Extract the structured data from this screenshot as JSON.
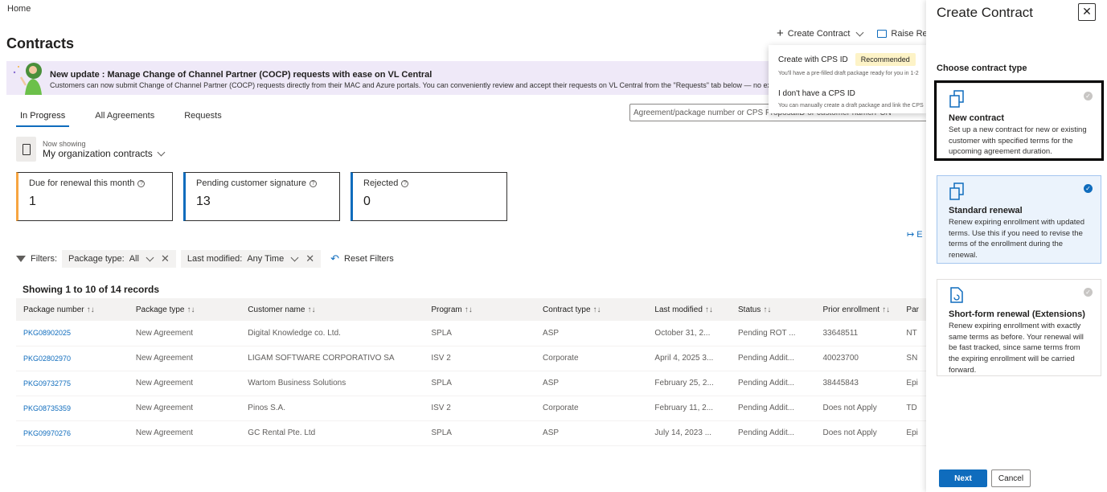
{
  "breadcrumb": "Home",
  "page_title": "Contracts",
  "top_actions": {
    "create_label": "Create Contract",
    "raise_label": "Raise Requ"
  },
  "banner": {
    "title": "New update : Manage Change of Channel Partner (COCP) requests with ease on VL Central",
    "text": "Customers can now submit Change of Channel Partner (COCP) requests directly from their MAC and Azure portals. You can conveniently review and accept their requests on VL Central from the \"Requests\" tab below — no extra steps"
  },
  "tabs": [
    "In Progress",
    "All Agreements",
    "Requests"
  ],
  "search": {
    "placeholder": "Agreement/package number or CPS ProposalID or customer name/PCN"
  },
  "showing": {
    "label": "Now showing",
    "value": "My organization contracts"
  },
  "cards": [
    {
      "label": "Due for renewal this month",
      "value": "1",
      "color": "#f7a541"
    },
    {
      "label": "Pending customer signature",
      "value": "13",
      "color": "#0f6cbd"
    },
    {
      "label": "Rejected",
      "value": "0",
      "color": "#0f6cbd"
    }
  ],
  "export_label": "E",
  "filters": {
    "label": "Filters:",
    "package_type": {
      "name": "Package type:",
      "value": "All"
    },
    "last_modified": {
      "name": "Last modified:",
      "value": "Any Time"
    },
    "reset": "Reset Filters"
  },
  "records": "Showing 1 to 10 of 14 records",
  "table": {
    "headers": [
      "Package number",
      "Package type",
      "Customer name",
      "Program",
      "Contract type",
      "Last modified",
      "Status",
      "Prior enrollment",
      "Par"
    ],
    "rows": [
      [
        "PKG08902025",
        "New Agreement",
        "Digital Knowledge co. Ltd.",
        "SPLA",
        "ASP",
        "October 31, 2...",
        "Pending ROT ...",
        "33648511",
        "NT"
      ],
      [
        "PKG02802970",
        "New Agreement",
        "LIGAM SOFTWARE CORPORATIVO SA",
        "ISV 2",
        "Corporate",
        "April 4, 2025 3...",
        "Pending Addit...",
        "40023700",
        "SN"
      ],
      [
        "PKG09732775",
        "New Agreement",
        "Wartom Business Solutions",
        "SPLA",
        "ASP",
        "February 25, 2...",
        "Pending Addit...",
        "38445843",
        "Epi"
      ],
      [
        "PKG08735359",
        "New Agreement",
        "Pinos S.A.",
        "ISV 2",
        "Corporate",
        "February 11, 2...",
        "Pending Addit...",
        "Does not Apply",
        "TD"
      ],
      [
        "PKG09970276",
        "New Agreement",
        "GC Rental Pte. Ltd",
        "SPLA",
        "ASP",
        "July 14, 2023 ...",
        "Pending Addit...",
        "Does not Apply",
        "Epi"
      ]
    ]
  },
  "dropdown": {
    "item1": {
      "label": "Create with CPS ID",
      "badge": "Recommended",
      "desc": "You'll have a pre-filled draft package ready for you in 1-2"
    },
    "item2": {
      "label": "I don't have a CPS ID",
      "desc": "You can manually create a draft package and link the CPS"
    }
  },
  "panel": {
    "title": "Create Contract",
    "close": "✕",
    "choose": "Choose contract type",
    "options": [
      {
        "title": "New contract",
        "desc": "Set up a new contract for new or existing customer with specified terms for the upcoming agreement duration.",
        "check": "✓"
      },
      {
        "title": "Standard renewal",
        "desc": "Renew expiring enrollment with updated terms. Use this if you need to revise the terms of the enrollment during the renewal.",
        "check": "✓"
      },
      {
        "title": "Short-form renewal (Extensions)",
        "desc": "Renew expiring enrollment with exactly same terms as before. Your renewal will be fast tracked, since same terms from the expiring enrollment will be carried forward.",
        "check": "✓"
      }
    ],
    "next": "Next",
    "cancel": "Cancel"
  },
  "colors": {
    "accent": "#0f6cbd",
    "banner_bg": "#efe9f8",
    "badge_bg": "#fdf3c7",
    "selected_bg": "#ebf3fc"
  }
}
